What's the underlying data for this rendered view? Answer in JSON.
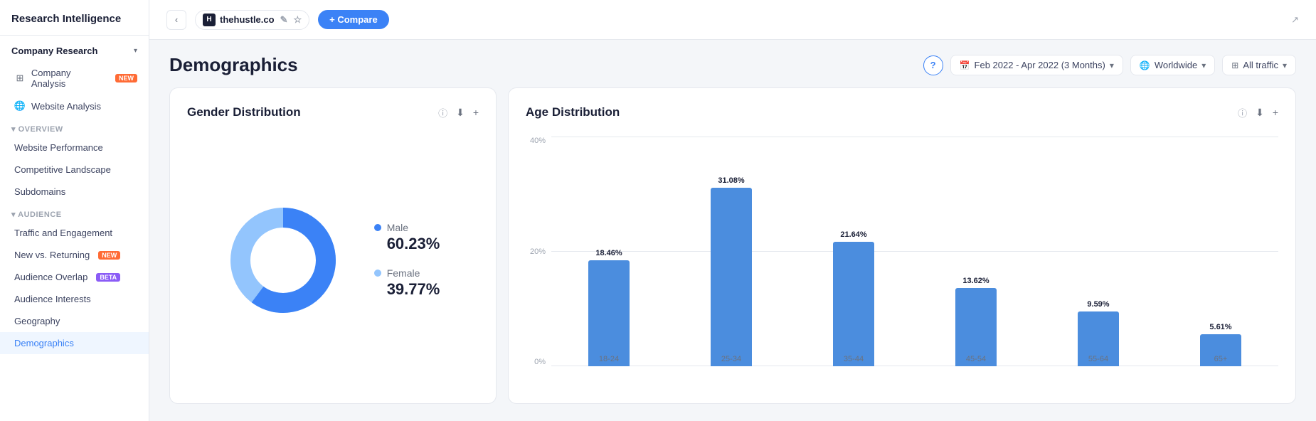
{
  "app": {
    "title": "Research Intelligence",
    "expand_icon": "↗"
  },
  "topbar": {
    "back_icon": "‹",
    "site": {
      "favicon_letter": "H",
      "name": "thehustle.co",
      "edit_icon": "✎",
      "star_icon": "☆"
    },
    "compare_label": "+ Compare"
  },
  "sidebar": {
    "company_research_label": "Company Research",
    "company_analysis_label": "Company Analysis",
    "company_analysis_badge": "NEW",
    "website_analysis_label": "Website Analysis",
    "overview_label": "Overview",
    "website_performance_label": "Website Performance",
    "competitive_landscape_label": "Competitive Landscape",
    "subdomains_label": "Subdomains",
    "audience_label": "Audience",
    "traffic_label": "Traffic and Engagement",
    "new_vs_returning_label": "New vs. Returning",
    "new_vs_returning_badge": "NEW",
    "audience_overlap_label": "Audience Overlap",
    "audience_overlap_badge": "BETA",
    "audience_interests_label": "Audience Interests",
    "geography_label": "Geography",
    "demographics_label": "Demographics"
  },
  "page": {
    "title": "Demographics",
    "date_range": "Feb 2022 - Apr 2022 (3 Months)",
    "region": "Worldwide",
    "traffic": "All traffic"
  },
  "gender_chart": {
    "title": "Gender Distribution",
    "male_label": "Male",
    "male_value": "60.23%",
    "female_label": "Female",
    "female_value": "39.77%",
    "male_pct": 60.23,
    "female_pct": 39.77
  },
  "age_chart": {
    "title": "Age Distribution",
    "y_labels": [
      "0%",
      "20%",
      "40%"
    ],
    "bars": [
      {
        "label": "18-24",
        "value": "18.46%",
        "pct": 18.46
      },
      {
        "label": "25-34",
        "value": "31.08%",
        "pct": 31.08
      },
      {
        "label": "35-44",
        "value": "21.64%",
        "pct": 21.64
      },
      {
        "label": "45-54",
        "value": "13.62%",
        "pct": 13.62
      },
      {
        "label": "55-64",
        "value": "9.59%",
        "pct": 9.59
      },
      {
        "label": "65+",
        "value": "5.61%",
        "pct": 5.61
      }
    ]
  },
  "colors": {
    "male_blue": "#3b82f6",
    "female_light_blue": "#93c5fd",
    "bar_blue": "#4b8dde",
    "active_nav": "#3b82f6"
  }
}
